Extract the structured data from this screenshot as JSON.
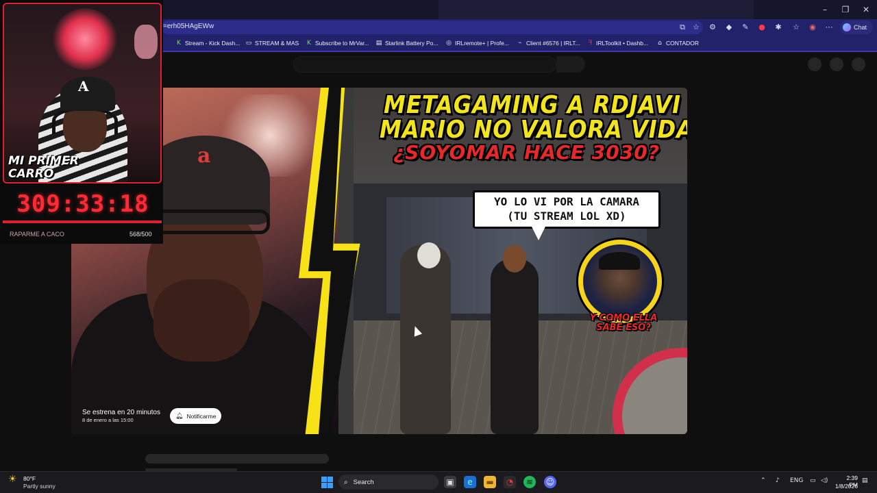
{
  "browser": {
    "url": "=erh05HAgEWw",
    "chat_label": "Chat",
    "window_controls": [
      "minimize-icon",
      "maximize-icon",
      "close-icon"
    ],
    "bookmarks": [
      {
        "label": "Stream - Kick Dash...",
        "icon": "kick-icon"
      },
      {
        "label": "STREAM & MAS",
        "icon": "folder-icon"
      },
      {
        "label": "Subscribe to MrVar...",
        "icon": "kick-icon"
      },
      {
        "label": "Starlink Battery Po...",
        "icon": "page-icon"
      },
      {
        "label": "IRLremote+ | Profe...",
        "icon": "globe-icon"
      },
      {
        "label": "Client #6576 | IRLT...",
        "icon": "client-icon"
      },
      {
        "label": "IRLToolkit • Dashb...",
        "icon": "irltoolkit-icon"
      },
      {
        "label": "CONTADOR",
        "icon": "contador-icon"
      }
    ]
  },
  "video": {
    "title_lines": [
      "METAGAMING A RDJAVI",
      "MARIO NO VALORA VIDA",
      "¿SOYOMAR HACE 3030?"
    ],
    "bubble_text": "YO LO VI POR LA CAMARA (TU STREAM LOL XD)",
    "pip_caption": "Y COMO ELLA SABE ESO?",
    "premiere_title": "Se estrena en 20 minutos",
    "premiere_date": "8 de enero a las 15:00",
    "notify_label": "Notificarme"
  },
  "overlay": {
    "title": "MI PRIMER CARRO",
    "timer": "309:33:18",
    "goal_label": "RAPARME A CACO",
    "goal_count": "568/500",
    "progress_fraction": 1.0
  },
  "taskbar": {
    "weather_temp": "80°F",
    "weather_desc": "Partly sunny",
    "search_label": "Search",
    "language": "ENG",
    "time": "2:39 PM",
    "date": "1/8/2026"
  },
  "colors": {
    "accent_red": "#e02030",
    "title_yellow": "#f4e51a",
    "browser_bar": "#22226a"
  }
}
